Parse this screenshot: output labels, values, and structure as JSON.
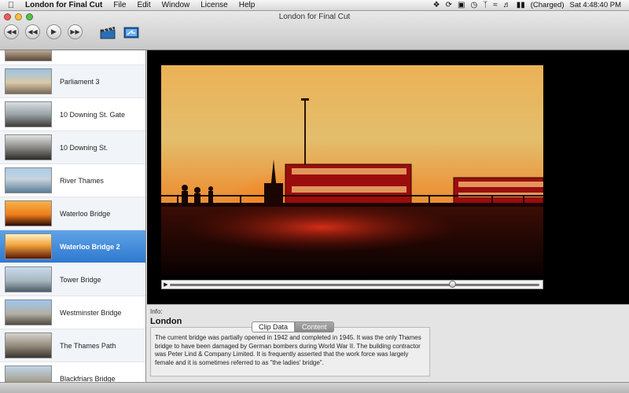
{
  "menubar": {
    "apple_icon": "apple-icon",
    "app_name": "London for Final Cut",
    "items": [
      "File",
      "Edit",
      "Window",
      "License",
      "Help"
    ],
    "battery_status": "(Charged)",
    "clock": "Sat 4:48:40 PM"
  },
  "window": {
    "title": "London for Final Cut"
  },
  "toolbar": {
    "buttons": [
      "skip-back-icon",
      "rewind-icon",
      "play-icon",
      "fast-forward-icon"
    ],
    "tools": [
      "clapper-board-icon",
      "export-to-final-cut-icon"
    ]
  },
  "sidebar": {
    "items": [
      {
        "label": "",
        "thumb": "street"
      },
      {
        "label": "Parliament 3",
        "thumb": "parliament"
      },
      {
        "label": "10 Downing St. Gate",
        "thumb": "gate"
      },
      {
        "label": "10 Downing St.",
        "thumb": "downing"
      },
      {
        "label": "River Thames",
        "thumb": "river"
      },
      {
        "label": "Waterloo Bridge",
        "thumb": "sunset"
      },
      {
        "label": "Waterloo Bridge 2",
        "thumb": "sunset2",
        "selected": true
      },
      {
        "label": "Tower Bridge",
        "thumb": "tower"
      },
      {
        "label": "Westminster Bridge",
        "thumb": "westminster"
      },
      {
        "label": "The Thames Path",
        "thumb": "path"
      },
      {
        "label": "Blackfriars Bridge",
        "thumb": "blackfriars"
      }
    ]
  },
  "player": {
    "progress_fraction": 0.765
  },
  "info": {
    "label": "Info:",
    "title": "London",
    "tabs": [
      "Clip Data",
      "Content"
    ],
    "active_tab": "Clip Data",
    "description": "The current bridge was partially opened in 1942 and completed in 1945. It was the only Thames bridge to have been damaged by German bombers during World War II. The building contractor was Peter Lind & Company Limited. It is frequently asserted that the work force was largely female and it is sometimes referred to as \"the ladies' bridge\"."
  },
  "colors": {
    "selection": "#3a82d6",
    "sky_orange": "#ff9a1f",
    "sunset_red": "#d8141a"
  }
}
